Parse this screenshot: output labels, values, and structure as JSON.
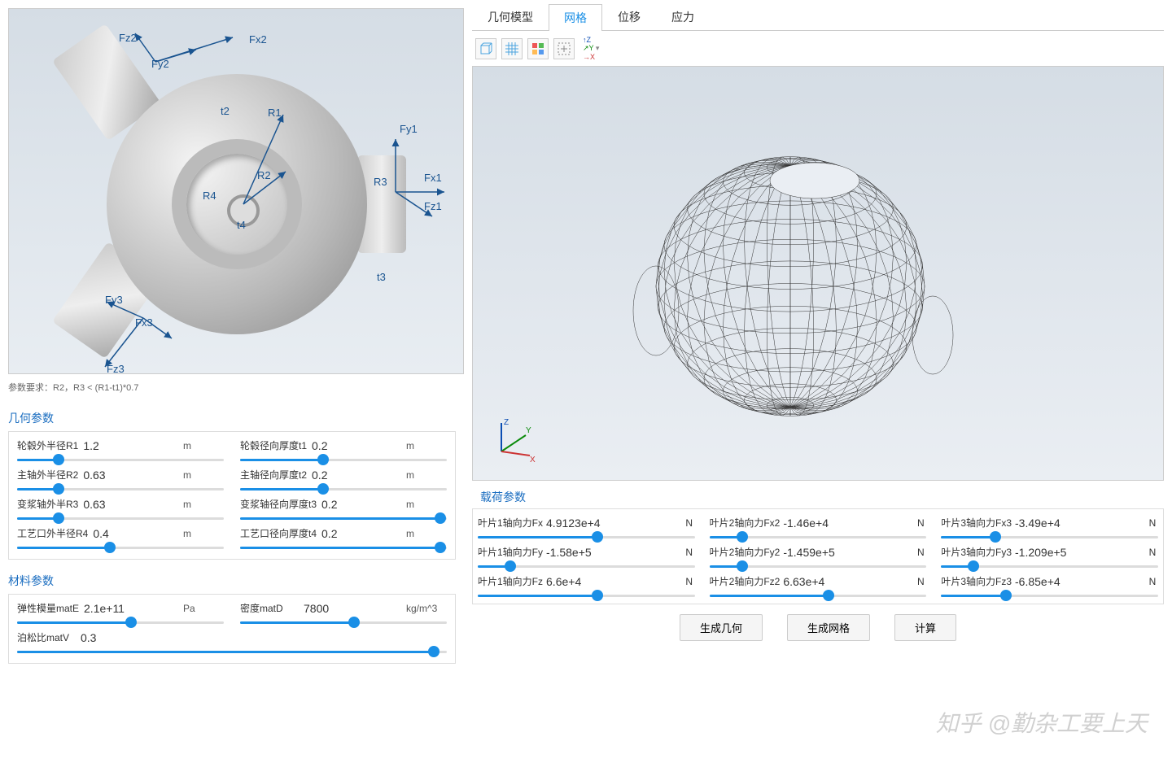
{
  "note": "参数要求：R2，R3 < (R1-t1)*0.7",
  "sections": {
    "geom": "几何参数",
    "mat": "材料参数",
    "load": "载荷参数"
  },
  "dim_labels": {
    "fz2": "Fz2",
    "fy2": "Fy2",
    "fx2": "Fx2",
    "fy1": "Fy1",
    "fx1": "Fx1",
    "fz1": "Fz1",
    "fy3": "Fy3",
    "fx3": "Fx3",
    "fz3": "Fz3",
    "r1": "R1",
    "r2": "R2",
    "r3": "R3",
    "r4": "R4",
    "t2": "t2",
    "t3": "t3",
    "t4": "t4"
  },
  "geom": [
    [
      {
        "label": "轮毂外半径R1",
        "value": "1.2",
        "unit": "m",
        "pct": 20
      },
      {
        "label": "轮毂径向厚度t1",
        "value": "0.2",
        "unit": "m",
        "pct": 40
      }
    ],
    [
      {
        "label": "主轴外半径R2",
        "value": "0.63",
        "unit": "m",
        "pct": 20
      },
      {
        "label": "主轴径向厚度t2",
        "value": "0.2",
        "unit": "m",
        "pct": 40
      }
    ],
    [
      {
        "label": "变浆轴外半R3",
        "value": "0.63",
        "unit": "m",
        "pct": 20
      },
      {
        "label": "变浆轴径向厚度t3",
        "value": "0.2",
        "unit": "m",
        "pct": 97
      }
    ],
    [
      {
        "label": "工艺口外半径R4",
        "value": "0.4",
        "unit": "m",
        "pct": 45
      },
      {
        "label": "工艺口径向厚度t4",
        "value": "0.2",
        "unit": "m",
        "pct": 97
      }
    ]
  ],
  "mat": [
    [
      {
        "label": "弹性模量matE",
        "value": "2.1e+11",
        "unit": "Pa",
        "pct": 55
      },
      {
        "label": "密度matD",
        "value": "7800",
        "unit": "kg/m^3",
        "pct": 55
      }
    ],
    [
      {
        "label": "泊松比matV",
        "value": "0.3",
        "unit": "",
        "pct": 97
      }
    ]
  ],
  "tabs": [
    "几何模型",
    "网格",
    "位移",
    "应力"
  ],
  "active_tab": 1,
  "loads": [
    [
      {
        "label": "叶片1轴向力Fx",
        "value": "4.9123e+4",
        "unit": "N",
        "pct": 55
      },
      {
        "label": "叶片2轴向力Fx2",
        "value": "-1.46e+4",
        "unit": "N",
        "pct": 15
      },
      {
        "label": "叶片3轴向力Fx3",
        "value": "-3.49e+4",
        "unit": "N",
        "pct": 25
      }
    ],
    [
      {
        "label": "叶片1轴向力Fy",
        "value": "-1.58e+5",
        "unit": "N",
        "pct": 15
      },
      {
        "label": "叶片2轴向力Fy2",
        "value": "-1.459e+5",
        "unit": "N",
        "pct": 15
      },
      {
        "label": "叶片3轴向力Fy3",
        "value": "-1.209e+5",
        "unit": "N",
        "pct": 15
      }
    ],
    [
      {
        "label": "叶片1轴向力Fz",
        "value": "6.6e+4",
        "unit": "N",
        "pct": 55
      },
      {
        "label": "叶片2轴向力Fz2",
        "value": "6.63e+4",
        "unit": "N",
        "pct": 55
      },
      {
        "label": "叶片3轴向力Fz3",
        "value": "-6.85e+4",
        "unit": "N",
        "pct": 30
      }
    ]
  ],
  "buttons": {
    "gen_geom": "生成几何",
    "gen_mesh": "生成网格",
    "calc": "计算"
  },
  "watermark": "知乎 @勤杂工要上天"
}
